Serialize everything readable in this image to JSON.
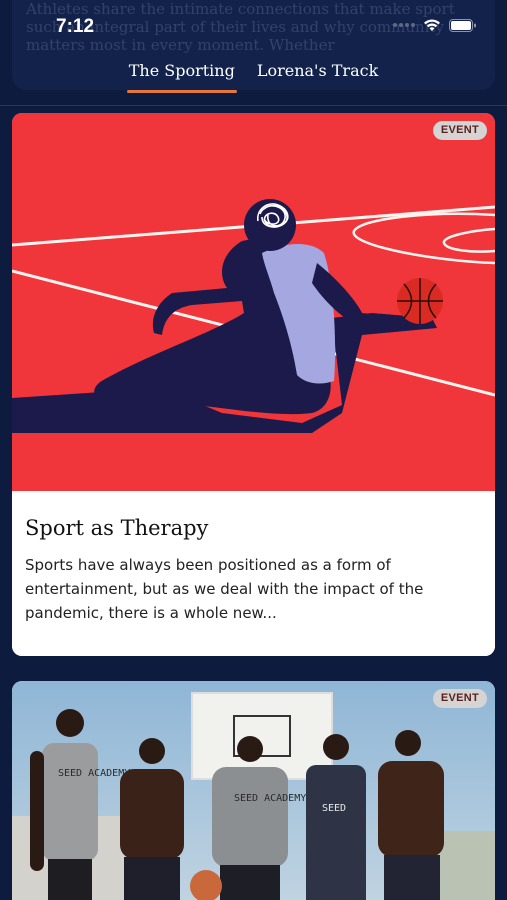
{
  "status_bar": {
    "time": "7:12"
  },
  "ghost_text": [
    "Athletes share the intimate connections that make sport",
    "such an integral part of their lives and why community",
    "matters most in every moment. Whether"
  ],
  "tabs": [
    {
      "label": "The Sporting",
      "active": true
    },
    {
      "label": "Lorena's Track",
      "active": false
    }
  ],
  "cards": [
    {
      "badge": "EVENT",
      "title": "Sport as Therapy",
      "description": "Sports have always been positioned as a form of entertainment, but as we deal with the impact of the pandemic, there is a whole new..."
    },
    {
      "badge": "EVENT",
      "shirt_texts": [
        "SEED ACADEMY",
        "SEED ACADEMY",
        "SEED"
      ]
    }
  ],
  "colors": {
    "background": "#0d1b3f",
    "tab_underline": "#e6763a",
    "art_red": "#f0363a",
    "art_navy": "#1c1a4a",
    "art_lavender": "#a4a7e0",
    "ball": "#d92b22"
  },
  "icons": [
    "cellular-dots-icon",
    "wifi-icon",
    "battery-icon"
  ]
}
